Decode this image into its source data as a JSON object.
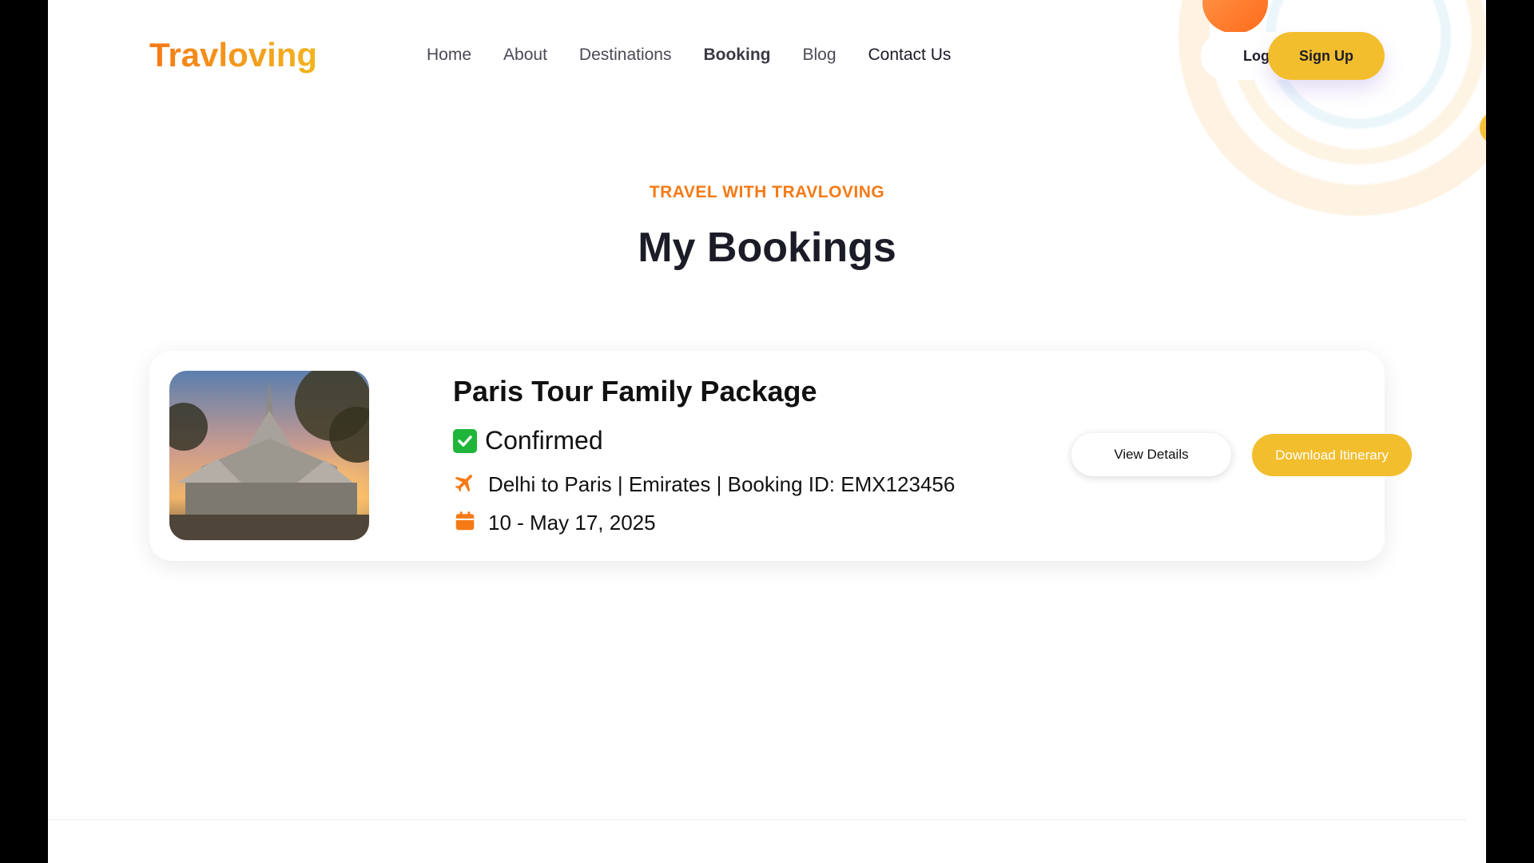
{
  "header": {
    "logo": "Travloving",
    "nav": [
      "Home",
      "About",
      "Destinations",
      "Booking",
      "Blog",
      "Contact Us"
    ],
    "login_label": "Log In",
    "signup_label": "Sign Up"
  },
  "hero": {
    "kicker": "TRAVEL WITH TRAVLOVING",
    "title": "My Bookings"
  },
  "booking": {
    "title": "Paris Tour Family Package",
    "status_icon": "white-check-mark-icon",
    "status": "Confirmed",
    "route": "Delhi to Paris | Emirates | Booking ID: EMX123456",
    "dates": "10 - May 17, 2025",
    "view_label": "View Details",
    "download_label": "Download Itinerary"
  },
  "colors": {
    "accent_orange": "#f57a16",
    "accent_yellow": "#f2be2e",
    "status_green": "#1eb53a"
  }
}
